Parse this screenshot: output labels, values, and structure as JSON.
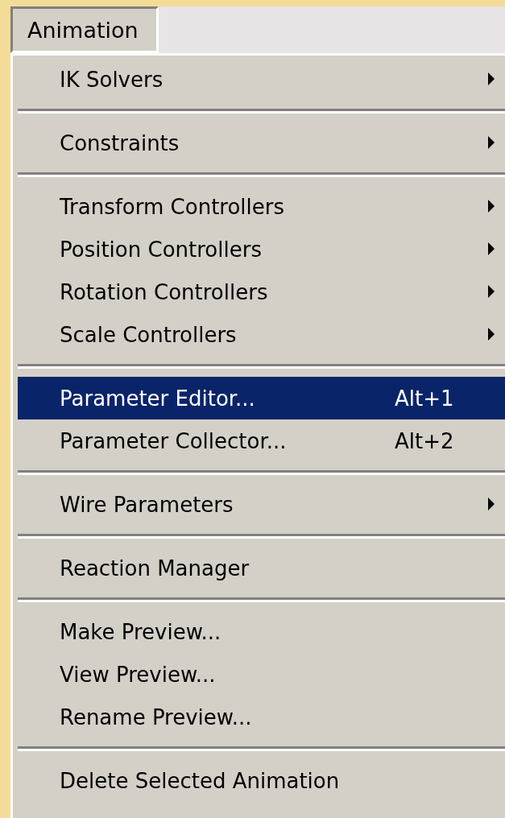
{
  "menu_bar": {
    "menus": [
      {
        "label": "Animation",
        "selected": true
      }
    ]
  },
  "menu": {
    "sections": [
      {
        "items": [
          {
            "label": "IK Solvers",
            "submenu": true,
            "selected": false
          }
        ]
      },
      {
        "items": [
          {
            "label": "Constraints",
            "submenu": true,
            "selected": false
          }
        ]
      },
      {
        "items": [
          {
            "label": "Transform Controllers",
            "submenu": true,
            "selected": false
          },
          {
            "label": "Position Controllers",
            "submenu": true,
            "selected": false
          },
          {
            "label": "Rotation Controllers",
            "submenu": true,
            "selected": false
          },
          {
            "label": "Scale Controllers",
            "submenu": true,
            "selected": false
          }
        ]
      },
      {
        "items": [
          {
            "label": "Parameter Editor...",
            "shortcut": "Alt+1",
            "submenu": false,
            "selected": true
          },
          {
            "label": "Parameter Collector...",
            "shortcut": "Alt+2",
            "submenu": false,
            "selected": false
          }
        ]
      },
      {
        "items": [
          {
            "label": "Wire Parameters",
            "submenu": true,
            "selected": false
          }
        ]
      },
      {
        "items": [
          {
            "label": "Reaction Manager",
            "submenu": false,
            "selected": false
          }
        ]
      },
      {
        "items": [
          {
            "label": "Make Preview...",
            "submenu": false,
            "selected": false
          },
          {
            "label": "View Preview...",
            "submenu": false,
            "selected": false
          },
          {
            "label": "Rename Preview...",
            "submenu": false,
            "selected": false
          }
        ]
      },
      {
        "items": [
          {
            "label": "Delete Selected Animation",
            "submenu": false,
            "selected": false
          }
        ]
      }
    ]
  }
}
